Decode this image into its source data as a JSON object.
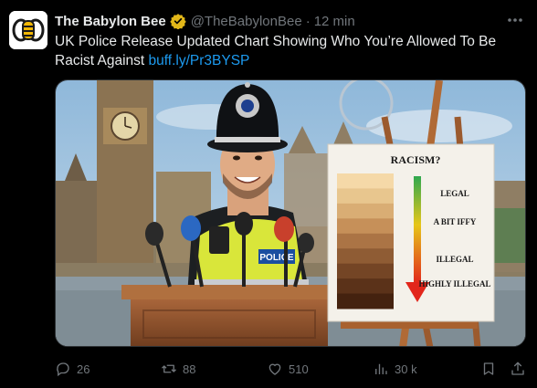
{
  "tweet": {
    "display_name": "The Babylon Bee",
    "handle": "@TheBabylonBee",
    "separator": "·",
    "time": "12 min",
    "more_icon": "more-icon",
    "text": "UK Police Release Updated Chart Showing Who You’re Allowed To Be Racist Against",
    "link": "buff.ly/Pr3BYSP",
    "verified_color": "#e2b719",
    "link_color": "#1d9bf0"
  },
  "media": {
    "chart_title": "RACISM?",
    "labels": [
      "LEGAL",
      "A BIT IFFY",
      "ILLEGAL",
      "HIGHLY ILLEGAL"
    ],
    "vest_label": "POLICE",
    "swatches": [
      "#f5d9a8",
      "#e8c68e",
      "#d9ad74",
      "#c69059",
      "#ab7445",
      "#8f5c34",
      "#744525",
      "#5b3219",
      "#44220f"
    ]
  },
  "actions": {
    "replies": "26",
    "reposts": "88",
    "likes": "510",
    "views": "30 k"
  }
}
